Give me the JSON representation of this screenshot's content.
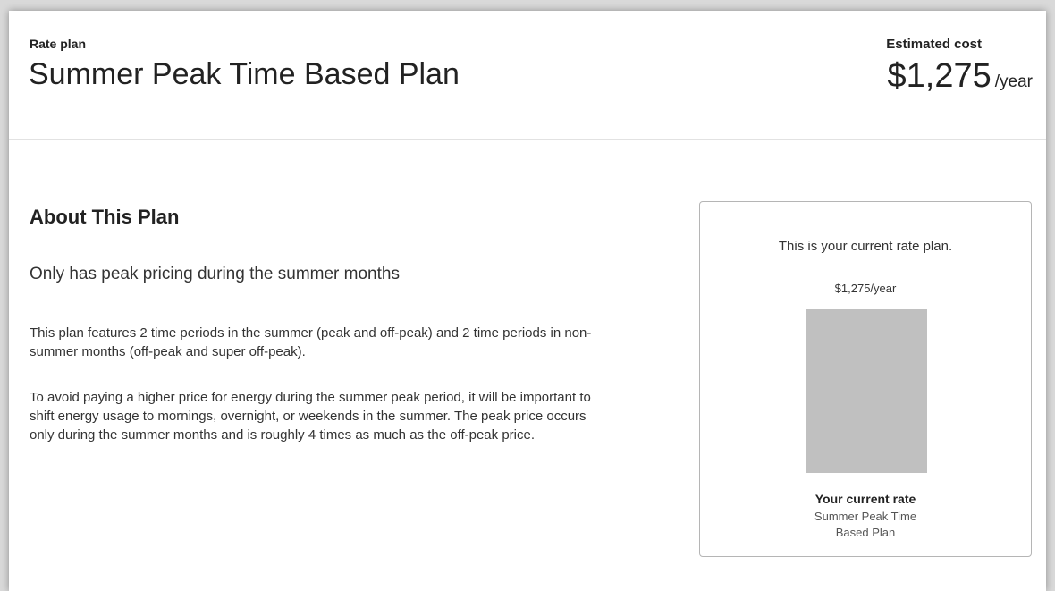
{
  "header": {
    "plan_eyebrow": "Rate plan",
    "plan_title": "Summer Peak Time Based Plan",
    "cost_eyebrow": "Estimated cost",
    "cost_amount": "$1,275",
    "cost_unit": "/year"
  },
  "about": {
    "heading": "About This Plan",
    "subtitle": "Only has peak pricing during the summer months",
    "paragraphs": [
      "This plan features 2 time periods in the summer (peak and off-peak) and 2 time periods in non-summer months (off-peak and super off-peak).",
      "To avoid paying a higher price for energy during the summer peak period, it will be important to shift energy usage to mornings, overnight, or weekends in the summer. The peak price occurs only during the summer months and is roughly 4 times as much as the off-peak price."
    ]
  },
  "card": {
    "message": "This is your current rate plan.",
    "bar_label": "$1,275/year",
    "bar_color": "#c0c0c0",
    "rate_title": "Your current rate",
    "rate_name": "Summer Peak Time Based Plan"
  }
}
